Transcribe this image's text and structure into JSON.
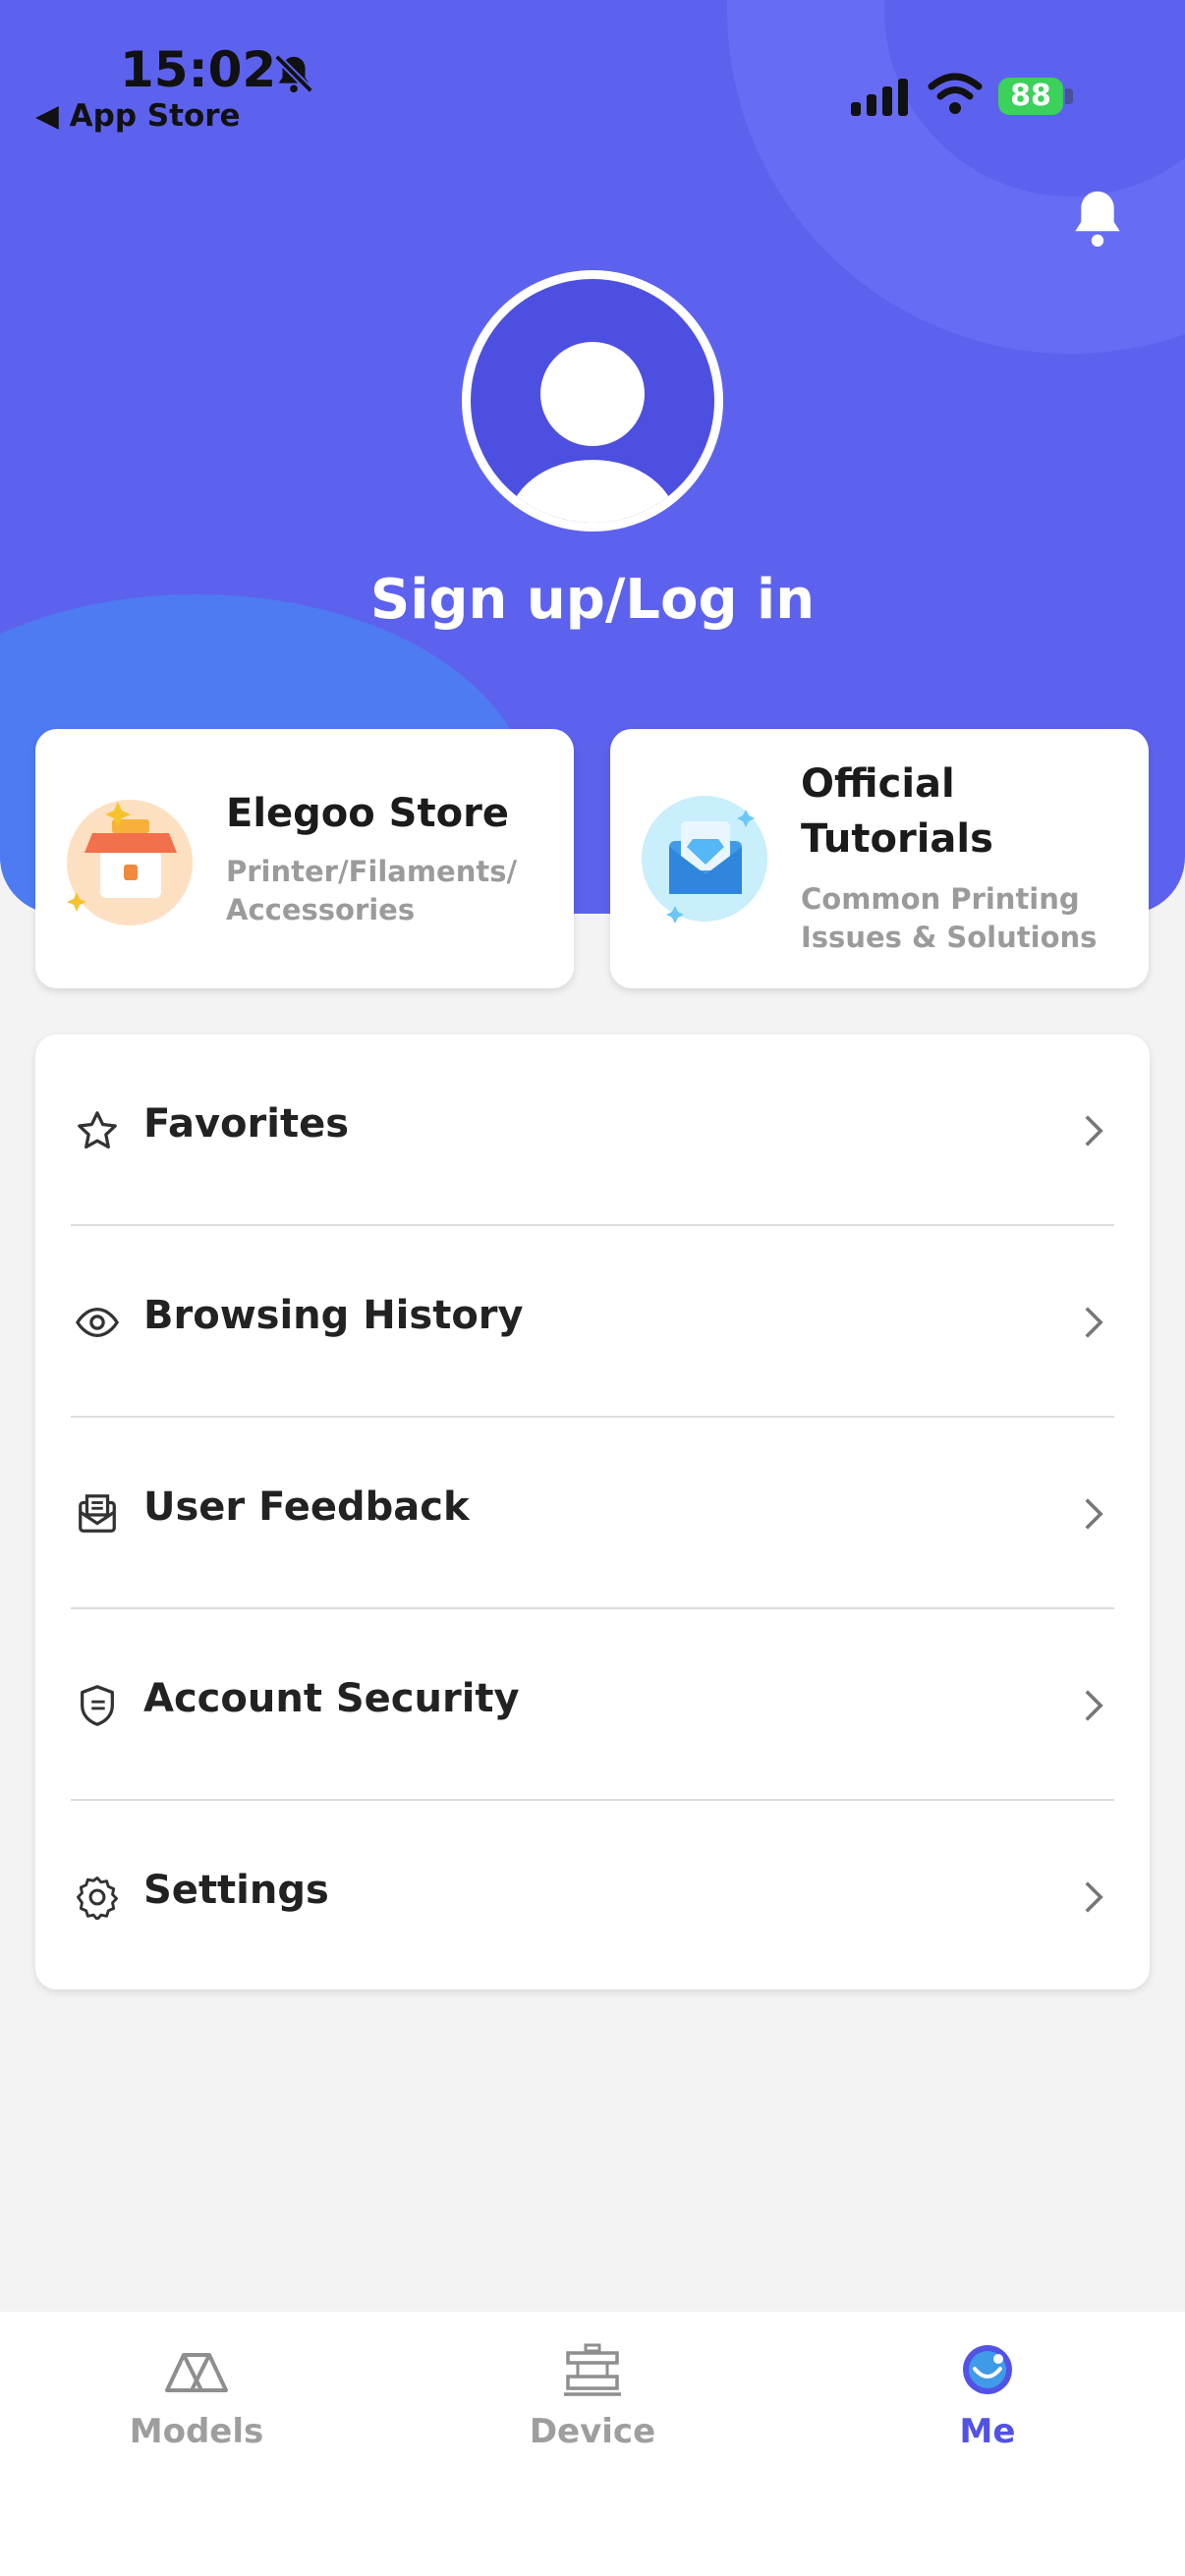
{
  "status_bar": {
    "time": "15:02",
    "back_app": "◀ App Store",
    "battery": "88"
  },
  "header": {
    "signin_label": "Sign up/Log in"
  },
  "cards": {
    "store": {
      "title": "Elegoo Store",
      "subtitle_1": "Printer/Filaments/",
      "subtitle_2": "Accessories"
    },
    "tutorials": {
      "title_1": "Official",
      "title_2": "Tutorials",
      "subtitle_1": "Common Printing",
      "subtitle_2": "Issues & Solutions"
    }
  },
  "menu": {
    "items": [
      {
        "label": "Favorites",
        "icon": "star-icon"
      },
      {
        "label": "Browsing History",
        "icon": "eye-icon"
      },
      {
        "label": "User Feedback",
        "icon": "feedback-icon"
      },
      {
        "label": "Account Security",
        "icon": "shield-icon"
      },
      {
        "label": "Settings",
        "icon": "gear-icon"
      }
    ]
  },
  "tabbar": {
    "tabs": [
      {
        "label": "Models",
        "icon": "models-icon",
        "active": false
      },
      {
        "label": "Device",
        "icon": "printer-icon",
        "active": false
      },
      {
        "label": "Me",
        "icon": "me-icon",
        "active": true
      }
    ]
  },
  "colors": {
    "hero": "#5d62ee",
    "accent": "#5252e6",
    "inactive_tab": "#9e9e9e",
    "battery": "#3bd15b"
  }
}
